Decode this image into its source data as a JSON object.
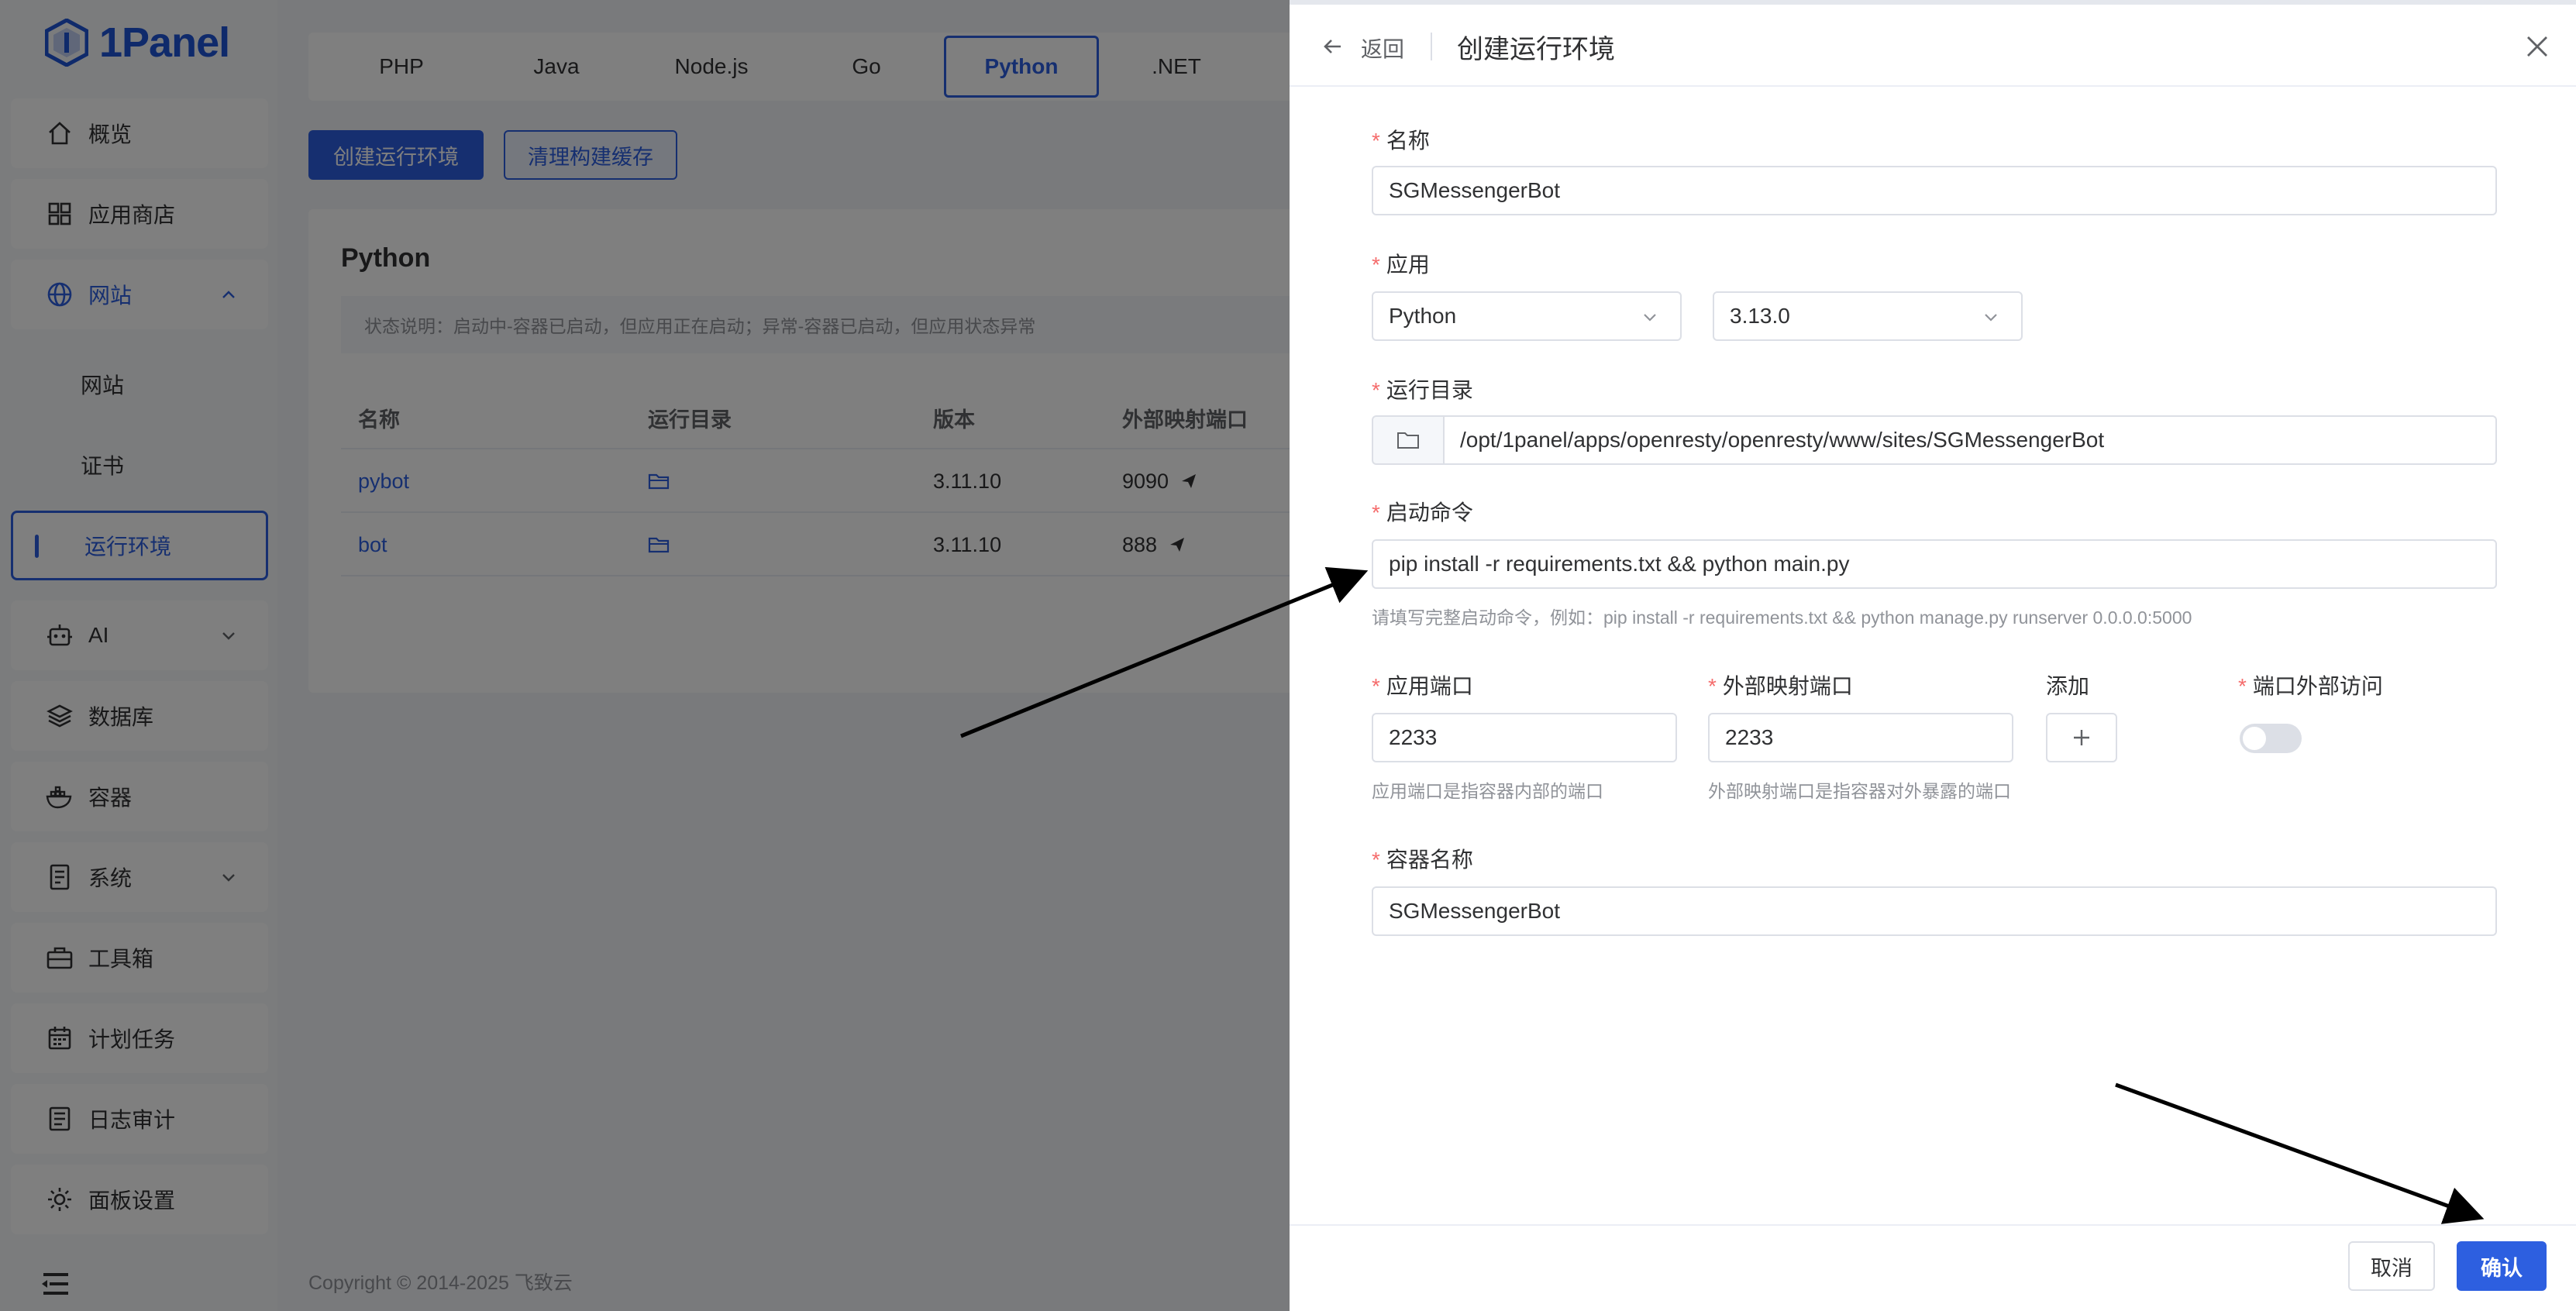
{
  "app": {
    "logo_text": "1Panel"
  },
  "sidebar": {
    "items": [
      {
        "label": "概览",
        "icon": "home-icon"
      },
      {
        "label": "应用商店",
        "icon": "apps-icon"
      },
      {
        "label": "网站",
        "icon": "globe-icon",
        "expanded": true
      },
      {
        "label": "AI",
        "icon": "robot-icon"
      },
      {
        "label": "数据库",
        "icon": "database-icon"
      },
      {
        "label": "容器",
        "icon": "docker-icon"
      },
      {
        "label": "系统",
        "icon": "system-icon"
      },
      {
        "label": "工具箱",
        "icon": "toolbox-icon"
      },
      {
        "label": "计划任务",
        "icon": "calendar-icon"
      },
      {
        "label": "日志审计",
        "icon": "log-icon"
      },
      {
        "label": "面板设置",
        "icon": "settings-icon"
      }
    ],
    "sub_items": [
      {
        "label": "网站"
      },
      {
        "label": "证书"
      },
      {
        "label": "运行环境",
        "active": true
      }
    ]
  },
  "main": {
    "tabs": [
      "PHP",
      "Java",
      "Node.js",
      "Go",
      "Python",
      ".NET"
    ],
    "active_tab": "Python",
    "create_button": "创建运行环境",
    "clear_cache_button": "清理构建缓存",
    "card_title": "Python",
    "status_note": "状态说明：启动中-容器已启动，但应用正在启动；异常-容器已启动，但应用状态异常",
    "table": {
      "headers": [
        "名称",
        "运行目录",
        "版本",
        "外部映射端口"
      ],
      "rows": [
        {
          "name": "pybot",
          "version": "3.11.10",
          "port": "9090"
        },
        {
          "name": "bot",
          "version": "3.11.10",
          "port": "888"
        }
      ]
    },
    "footer": "Copyright © 2014-2025 飞致云"
  },
  "drawer": {
    "back_label": "返回",
    "title": "创建运行环境",
    "fields": {
      "name_label": "名称",
      "name_value": "SGMessengerBot",
      "app_label": "应用",
      "app_value": "Python",
      "version_value": "3.13.0",
      "dir_label": "运行目录",
      "dir_value": "/opt/1panel/apps/openresty/openresty/www/sites/SGMessengerBot",
      "cmd_label": "启动命令",
      "cmd_value": "pip install -r requirements.txt && python main.py",
      "cmd_hint": "请填写完整启动命令，例如：pip install -r requirements.txt && python manage.py runserver 0.0.0.0:5000",
      "app_port_label": "应用端口",
      "app_port_value": "2233",
      "app_port_hint": "应用端口是指容器内部的端口",
      "ext_port_label": "外部映射端口",
      "ext_port_value": "2233",
      "ext_port_hint": "外部映射端口是指容器对外暴露的端口",
      "add_label": "添加",
      "ext_access_label": "端口外部访问",
      "ext_access_on": false,
      "container_label": "容器名称",
      "container_value": "SGMessengerBot"
    },
    "cancel_button": "取消",
    "confirm_button": "确认"
  },
  "colors": {
    "primary": "#2d5fe0",
    "required": "#f56c6c"
  }
}
